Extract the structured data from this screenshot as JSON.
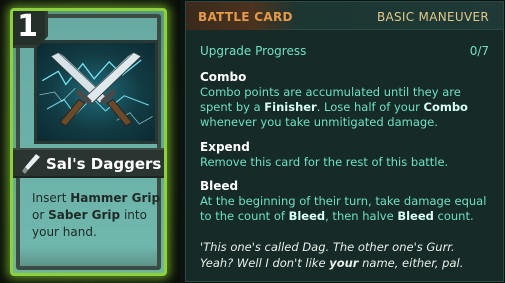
{
  "card": {
    "cost": "1",
    "name": "Sal's Daggers",
    "description_parts": {
      "p1": "Insert ",
      "k1": "Hammer Grip",
      "p2": " or ",
      "k2": "Saber Grip",
      "p3": " into your hand."
    },
    "art": "crossed-daggers-lightning",
    "border_color": "#8fd13a"
  },
  "panel": {
    "card_type": "BATTLE CARD",
    "card_subtype": "BASIC MANEUVER",
    "upgrade_label": "Upgrade Progress",
    "upgrade_count": "0/7",
    "sections": [
      {
        "title": "Combo",
        "body": {
          "a": "Combo points are accumulated until they are spent by a ",
          "b": "Finisher",
          "c": ". Lose half of your ",
          "d": "Combo",
          "e": " whenever you take unmitigated damage."
        }
      },
      {
        "title": "Expend",
        "body": {
          "a": "Remove this card for the rest of this battle."
        }
      },
      {
        "title": "Bleed",
        "body": {
          "a": "At the beginning of their turn, take damage equal to the count of ",
          "b": "Bleed",
          "c": ", then halve ",
          "d": "Bleed",
          "e": " count."
        }
      }
    ],
    "flavor": {
      "line1": "'This one's called Dag. The other one's Gurr.",
      "line2a": "Yeah? Well I don't like ",
      "line2b": "your",
      "line2c": " name, either, pal."
    }
  },
  "colors": {
    "accent_orange": "#e49a4a",
    "keyword_teal": "#6fe0c4",
    "panel_bg": "#162a28"
  }
}
